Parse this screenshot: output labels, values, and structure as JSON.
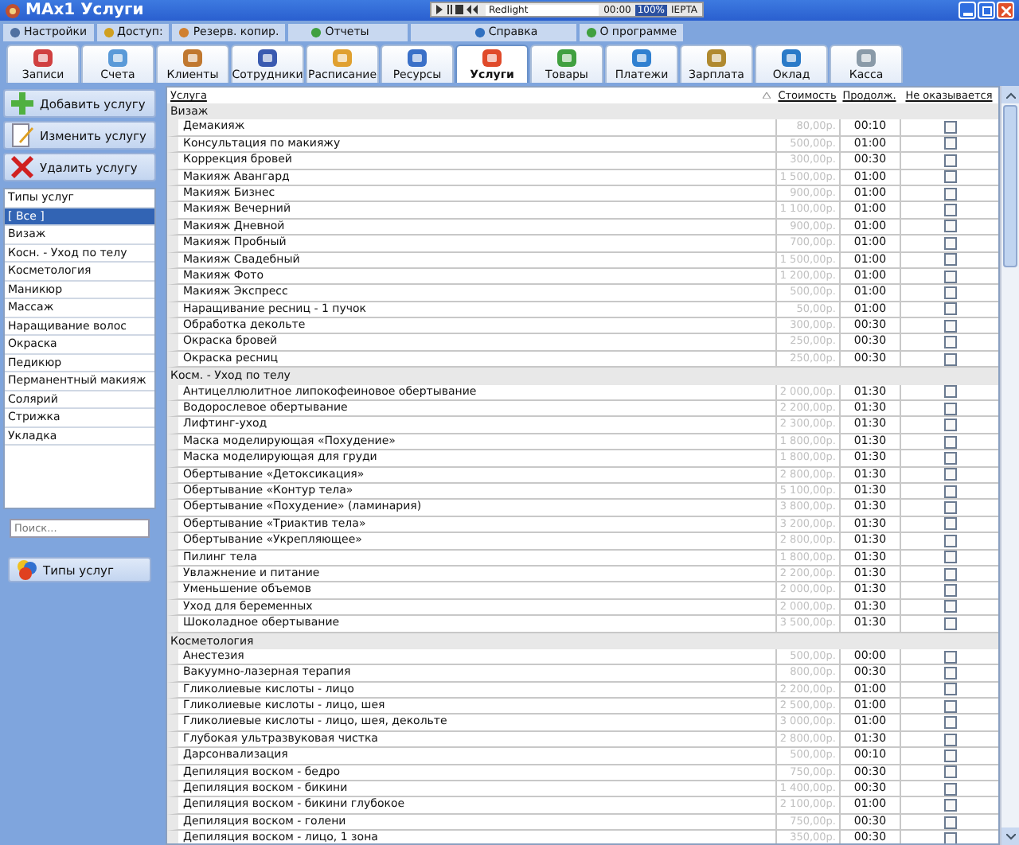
{
  "window": {
    "title": "MAx1 Услуги"
  },
  "media_player": {
    "track": "Redlight",
    "time": "00:00",
    "volume": "100%",
    "label": "IEPTA"
  },
  "menu": [
    {
      "label": "Настройки",
      "kind": "gear"
    },
    {
      "label": "Доступ:",
      "kind": "user"
    },
    {
      "label": "Резерв. копир.",
      "kind": "disk"
    },
    {
      "label": "Отчеты",
      "kind": "chart"
    },
    {
      "label": "Справка",
      "kind": "book"
    },
    {
      "label": "О программе",
      "kind": "info"
    }
  ],
  "tabs": [
    {
      "label": "Записи",
      "selected": false,
      "color": "#d04040"
    },
    {
      "label": "Счета",
      "selected": false,
      "color": "#5a9ad8"
    },
    {
      "label": "Клиенты",
      "selected": false,
      "color": "#c07830"
    },
    {
      "label": "Сотрудники",
      "selected": false,
      "color": "#3a5ab0"
    },
    {
      "label": "Расписание",
      "selected": false,
      "color": "#e0a030"
    },
    {
      "label": "Ресурсы",
      "selected": false,
      "color": "#3a70c8"
    },
    {
      "label": "Услуги",
      "selected": true,
      "color": "#e04a2a"
    },
    {
      "label": "Товары",
      "selected": false,
      "color": "#40a040"
    },
    {
      "label": "Платежи",
      "selected": false,
      "color": "#3080d0"
    },
    {
      "label": "Зарплата",
      "selected": false,
      "color": "#b08a30"
    },
    {
      "label": "Оклад",
      "selected": false,
      "color": "#2a7ac8"
    },
    {
      "label": "Касса",
      "selected": false,
      "color": "#8a9aa8"
    }
  ],
  "actions": [
    {
      "label": "Добавить услугу",
      "kind": "add"
    },
    {
      "label": "Изменить услугу",
      "kind": "edit"
    },
    {
      "label": "Удалить услугу",
      "kind": "delete"
    }
  ],
  "service_types": {
    "header": "Типы услуг",
    "items": [
      {
        "label": "[ Все ]",
        "selected": true
      },
      {
        "label": "Визаж",
        "selected": false
      },
      {
        "label": "Косн. - Уход по телу",
        "selected": false
      },
      {
        "label": "Косметология",
        "selected": false
      },
      {
        "label": "Маникюр",
        "selected": false
      },
      {
        "label": "Массаж",
        "selected": false
      },
      {
        "label": "Наращивание волос",
        "selected": false
      },
      {
        "label": "Окраска",
        "selected": false
      },
      {
        "label": "Педикюр",
        "selected": false
      },
      {
        "label": "Перманентный макияж",
        "selected": false
      },
      {
        "label": "Солярий",
        "selected": false
      },
      {
        "label": "Стрижка",
        "selected": false
      },
      {
        "label": "Укладка",
        "selected": false
      }
    ]
  },
  "search": {
    "placeholder": "Поиск..."
  },
  "types_button": {
    "label": "Типы услуг"
  },
  "table": {
    "columns": [
      "Услуга",
      "Стоимость",
      "Продолж.",
      "Не оказывается"
    ],
    "groups": [
      {
        "name": "Визаж",
        "rows": [
          {
            "name": "Демакияж",
            "price": "80,00р.",
            "duration": "00:10",
            "not_provided": false
          },
          {
            "name": "Консультация по макияжу",
            "price": "500,00р.",
            "duration": "01:00",
            "not_provided": false
          },
          {
            "name": "Коррекция бровей",
            "price": "300,00р.",
            "duration": "00:30",
            "not_provided": false
          },
          {
            "name": "Макияж Авангард",
            "price": "1 500,00р.",
            "duration": "01:00",
            "not_provided": false
          },
          {
            "name": "Макияж Бизнес",
            "price": "900,00р.",
            "duration": "01:00",
            "not_provided": false
          },
          {
            "name": "Макияж Вечерний",
            "price": "1 100,00р.",
            "duration": "01:00",
            "not_provided": false
          },
          {
            "name": "Макияж Дневной",
            "price": "900,00р.",
            "duration": "01:00",
            "not_provided": false
          },
          {
            "name": "Макияж Пробный",
            "price": "700,00р.",
            "duration": "01:00",
            "not_provided": false
          },
          {
            "name": "Макияж Свадебный",
            "price": "1 500,00р.",
            "duration": "01:00",
            "not_provided": false
          },
          {
            "name": "Макияж Фото",
            "price": "1 200,00р.",
            "duration": "01:00",
            "not_provided": false
          },
          {
            "name": "Макияж Экспресс",
            "price": "500,00р.",
            "duration": "01:00",
            "not_provided": false
          },
          {
            "name": "Наращивание ресниц - 1 пучок",
            "price": "50,00р.",
            "duration": "01:00",
            "not_provided": false
          },
          {
            "name": "Обработка декольте",
            "price": "300,00р.",
            "duration": "00:30",
            "not_provided": false
          },
          {
            "name": "Окраска бровей",
            "price": "250,00р.",
            "duration": "00:30",
            "not_provided": false
          },
          {
            "name": "Окраска ресниц",
            "price": "250,00р.",
            "duration": "00:30",
            "not_provided": false
          }
        ]
      },
      {
        "name": "Косм. - Уход по телу",
        "rows": [
          {
            "name": "Антицеллюлитное липокофеиновое обертывание",
            "price": "2 000,00р.",
            "duration": "01:30",
            "not_provided": false
          },
          {
            "name": "Водорослевое обертывание",
            "price": "2 200,00р.",
            "duration": "01:30",
            "not_provided": false
          },
          {
            "name": "Лифтинг-уход",
            "price": "2 300,00р.",
            "duration": "01:30",
            "not_provided": false
          },
          {
            "name": "Маска моделирующая «Похудение»",
            "price": "1 800,00р.",
            "duration": "01:30",
            "not_provided": false
          },
          {
            "name": "Маска моделирующая для груди",
            "price": "1 800,00р.",
            "duration": "01:30",
            "not_provided": false
          },
          {
            "name": "Обертывание «Детоксикация»",
            "price": "2 800,00р.",
            "duration": "01:30",
            "not_provided": false
          },
          {
            "name": "Обертывание «Контур тела»",
            "price": "5 100,00р.",
            "duration": "01:30",
            "not_provided": false
          },
          {
            "name": "Обертывание «Похудение» (ламинария)",
            "price": "3 800,00р.",
            "duration": "01:30",
            "not_provided": false
          },
          {
            "name": "Обертывание «Триактив тела»",
            "price": "3 200,00р.",
            "duration": "01:30",
            "not_provided": false
          },
          {
            "name": "Обертывание «Укрепляющее»",
            "price": "2 800,00р.",
            "duration": "01:30",
            "not_provided": false
          },
          {
            "name": "Пилинг тела",
            "price": "1 800,00р.",
            "duration": "01:30",
            "not_provided": false
          },
          {
            "name": "Увлажнение и питание",
            "price": "2 200,00р.",
            "duration": "01:30",
            "not_provided": false
          },
          {
            "name": "Уменьшение объемов",
            "price": "2 000,00р.",
            "duration": "01:30",
            "not_provided": false
          },
          {
            "name": "Уход для беременных",
            "price": "2 000,00р.",
            "duration": "01:30",
            "not_provided": false
          },
          {
            "name": "Шоколадное обертывание",
            "price": "3 500,00р.",
            "duration": "01:30",
            "not_provided": false
          }
        ]
      },
      {
        "name": "Косметология",
        "rows": [
          {
            "name": "Анестезия",
            "price": "500,00р.",
            "duration": "00:00",
            "not_provided": false
          },
          {
            "name": "Вакуумно-лазерная терапия",
            "price": "800,00р.",
            "duration": "00:30",
            "not_provided": false
          },
          {
            "name": "Гликолиевые кислоты - лицо",
            "price": "2 200,00р.",
            "duration": "01:00",
            "not_provided": false
          },
          {
            "name": "Гликолиевые кислоты - лицо, шея",
            "price": "2 500,00р.",
            "duration": "01:00",
            "not_provided": false
          },
          {
            "name": "Гликолиевые кислоты - лицо, шея, декольте",
            "price": "3 000,00р.",
            "duration": "01:00",
            "not_provided": false
          },
          {
            "name": "Глубокая ультразвуковая чистка",
            "price": "2 800,00р.",
            "duration": "01:30",
            "not_provided": false
          },
          {
            "name": "Дарсонвализация",
            "price": "500,00р.",
            "duration": "00:10",
            "not_provided": false
          },
          {
            "name": "Депиляция воском - бедро",
            "price": "750,00р.",
            "duration": "00:30",
            "not_provided": false
          },
          {
            "name": "Депиляция воском - бикини",
            "price": "1 400,00р.",
            "duration": "00:30",
            "not_provided": false
          },
          {
            "name": "Депиляция воском - бикини глубокое",
            "price": "2 100,00р.",
            "duration": "01:00",
            "not_provided": false
          },
          {
            "name": "Депиляция воском - голени",
            "price": "750,00р.",
            "duration": "00:30",
            "not_provided": false
          },
          {
            "name": "Депиляция воском - лицо, 1 зона",
            "price": "350,00р.",
            "duration": "00:30",
            "not_provided": false
          }
        ]
      }
    ]
  }
}
